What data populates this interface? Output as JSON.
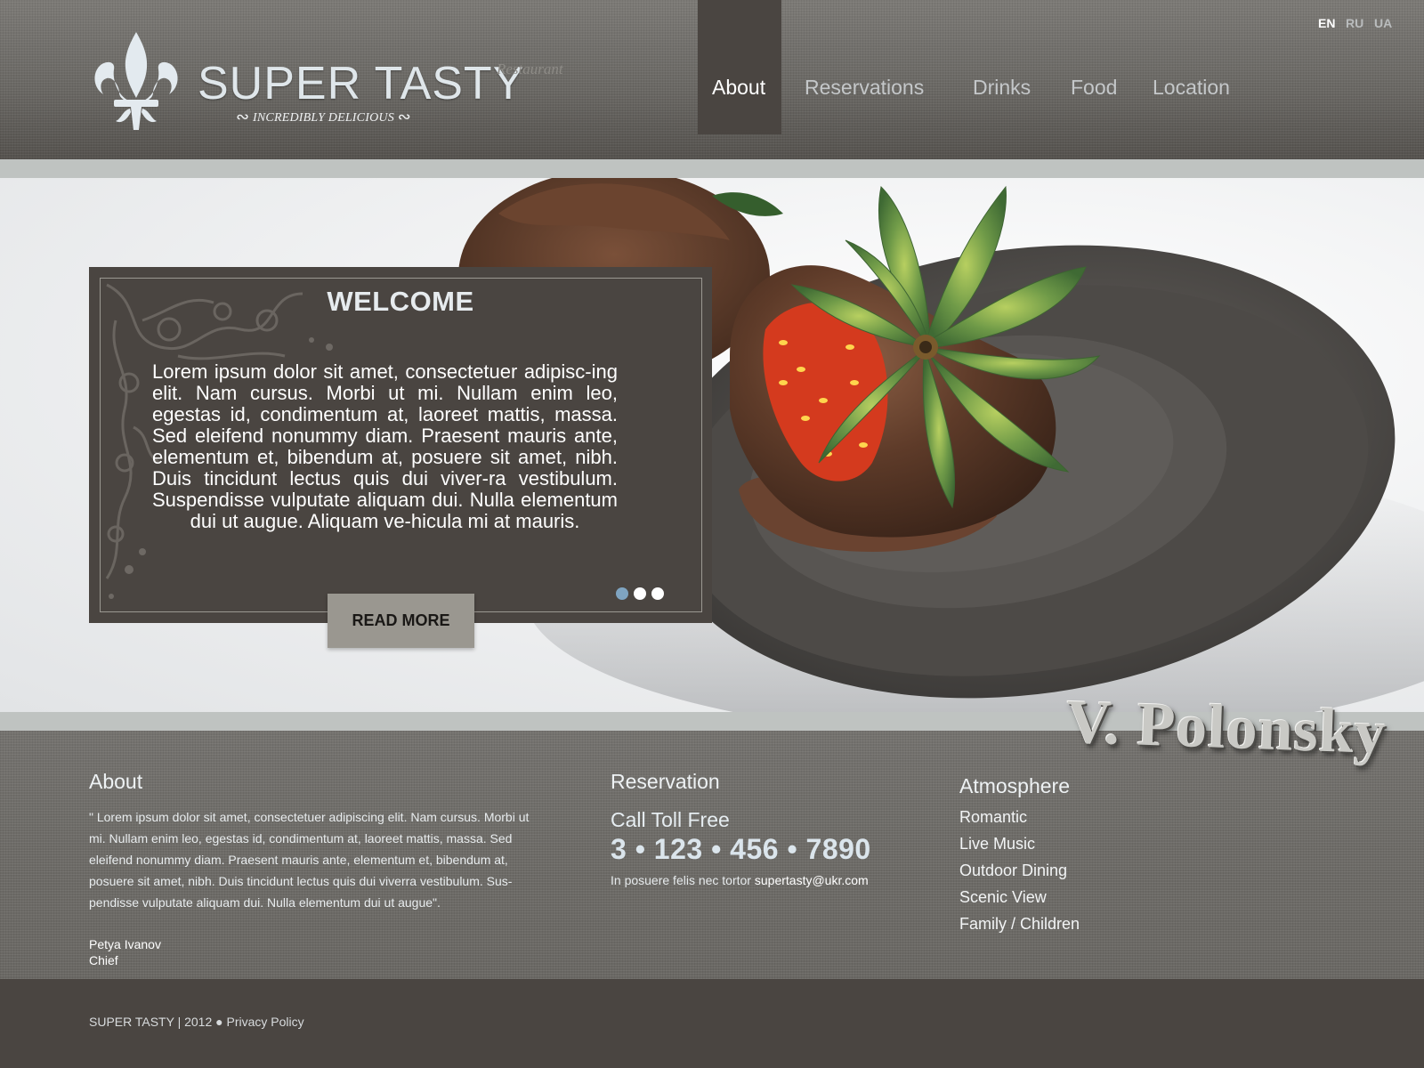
{
  "header": {
    "logo_title": "SUPER TASTY",
    "logo_subtitle": "Restaurant",
    "logo_tagline": "INCREDIBLY DELICIOUS",
    "nav": [
      "About",
      "Reservations",
      "Drinks",
      "Food",
      "Location"
    ],
    "active_nav": "About",
    "languages": [
      "EN",
      "RU",
      "UA"
    ],
    "active_language": "EN"
  },
  "hero": {
    "title": "WELCOME",
    "text": "Lorem ipsum dolor sit amet, consectetuer adipisc-ing elit. Nam cursus. Morbi ut mi. Nullam enim leo, egestas id, condimentum at, laoreet mattis, massa. Sed eleifend nonummy diam. Praesent mauris ante, elementum et, bibendum at, posuere sit amet, nibh. Duis tincidunt lectus quis dui viver-ra vestibulum. Suspendisse vulputate aliquam dui. Nulla elementum dui ut augue. Aliquam ve-hicula mi at mauris.",
    "read_more": "READ MORE",
    "slides_total": 3,
    "active_slide": 1
  },
  "about": {
    "heading": "About",
    "text": "\" Lorem ipsum dolor sit amet, consectetuer adipiscing elit. Nam cursus. Morbi ut mi. Nullam enim leo, egestas id, condimentum at, laoreet mattis, massa. Sed eleifend nonummy diam. Praesent mauris ante, elementum et, bibendum at, posuere sit amet, nibh. Duis tincidunt lectus quis dui viverra vestibulum. Sus-pendisse vulputate aliquam dui. Nulla elementum dui ut augue\".",
    "author_name": "Petya Ivanov",
    "author_role": "Chief"
  },
  "reservation": {
    "heading": "Reservation",
    "call_label": "Call Toll Free",
    "phone": "3 • 123 • 456 • 7890",
    "email_prefix": "In posuere felis nec tortor",
    "email": "supertasty@ukr.com"
  },
  "atmosphere": {
    "heading": "Atmosphere",
    "items": [
      "Romantic",
      "Live Music",
      "Outdoor Dining",
      "Scenic View",
      "Family / Children"
    ]
  },
  "watermark": "V. Polonsky",
  "footer": {
    "copyright": "SUPER TASTY | 2012 ●",
    "privacy": "Privacy Policy"
  },
  "colors": {
    "dark_panel": "#4a4541",
    "accent_dot": "#7fa4c1",
    "light_band": "#bfc3c1",
    "button": "#9a9790"
  }
}
